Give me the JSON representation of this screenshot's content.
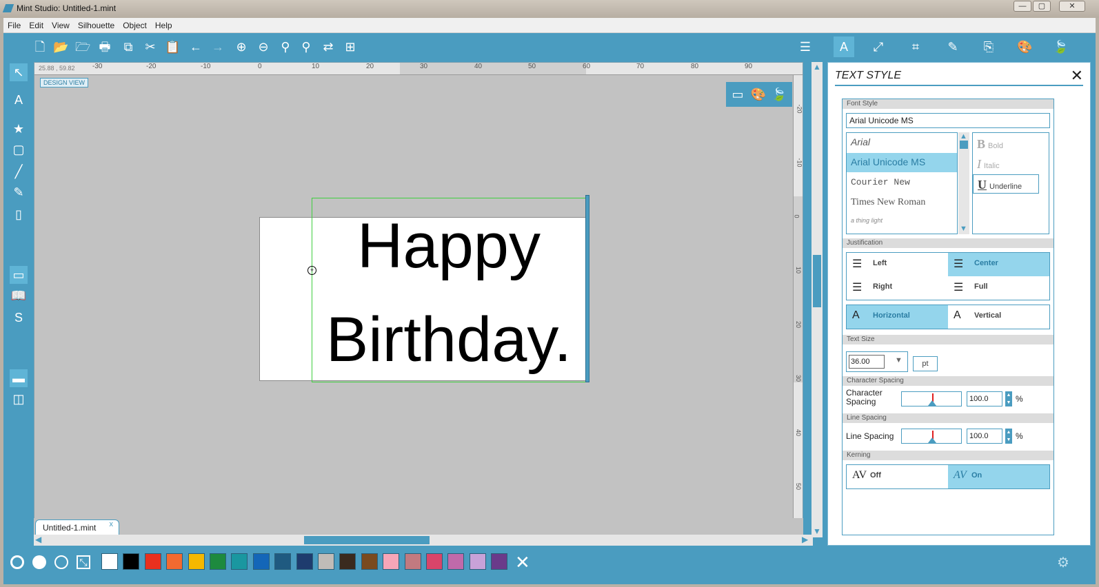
{
  "window": {
    "title": "Mint Studio: Untitled-1.mint",
    "min": "—",
    "max": "▢",
    "close": "✕"
  },
  "menu": [
    "File",
    "Edit",
    "View",
    "Silhouette",
    "Object",
    "Help"
  ],
  "toolbar": {
    "left": [
      {
        "name": "new-document-icon",
        "glyph": "🗋"
      },
      {
        "name": "open-folder-icon",
        "glyph": "📂"
      },
      {
        "name": "recent-folder-icon",
        "glyph": "🗁"
      },
      {
        "name": "print-icon",
        "glyph": "🖶"
      },
      {
        "name": "copy-icon",
        "glyph": "⧉"
      },
      {
        "name": "cut-icon",
        "glyph": "✂"
      },
      {
        "name": "paste-icon",
        "glyph": "📋"
      },
      {
        "name": "undo-icon",
        "glyph": "←"
      },
      {
        "name": "redo-icon",
        "glyph": "→"
      },
      {
        "name": "zoom-in-icon",
        "glyph": "⊕"
      },
      {
        "name": "zoom-out-icon",
        "glyph": "⊖"
      },
      {
        "name": "zoom-selection-icon",
        "glyph": "⚲"
      },
      {
        "name": "zoom-fit-icon",
        "glyph": "⚲"
      },
      {
        "name": "pan-icon",
        "glyph": "⇄"
      },
      {
        "name": "add-page-icon",
        "glyph": "⊞"
      }
    ],
    "right": [
      {
        "name": "page-setup-icon",
        "glyph": "☰"
      },
      {
        "name": "text-style-icon",
        "glyph": "A"
      },
      {
        "name": "transform-icon",
        "glyph": "⤢"
      },
      {
        "name": "crop-icon",
        "glyph": "⌗"
      },
      {
        "name": "trace-icon",
        "glyph": "✎"
      },
      {
        "name": "send-icon",
        "glyph": "⎘"
      },
      {
        "name": "fill-color-icon",
        "glyph": "🎨"
      },
      {
        "name": "library-icon",
        "glyph": "🍃"
      }
    ]
  },
  "left_tools": [
    {
      "name": "select-tool-icon",
      "glyph": "↖"
    },
    {
      "name": "text-tool-icon",
      "glyph": "A"
    },
    {
      "name": "shape-tool-icon",
      "glyph": "★"
    },
    {
      "name": "rectangle-tool-icon",
      "glyph": "▢"
    },
    {
      "name": "line-tool-icon",
      "glyph": "╱"
    },
    {
      "name": "draw-tool-icon",
      "glyph": "✎"
    },
    {
      "name": "eraser-tool-icon",
      "glyph": "▯"
    },
    {
      "name": "design-page-icon",
      "glyph": "▭"
    },
    {
      "name": "library-book-icon",
      "glyph": "📖"
    },
    {
      "name": "silhouette-store-icon",
      "glyph": "S"
    },
    {
      "name": "single-view-icon",
      "glyph": "▬"
    },
    {
      "name": "split-view-icon",
      "glyph": "◫"
    }
  ],
  "canvas": {
    "design_view_label": "DESIGN VIEW",
    "ruler_coords": "25.88 , 59.82",
    "ruler_h_labels": [
      "-30",
      "-20",
      "-10",
      "0",
      "10",
      "20",
      "30",
      "40",
      "50",
      "60",
      "70",
      "80",
      "90"
    ],
    "ruler_v_labels": [
      "-20",
      "-10",
      "0",
      "10",
      "20",
      "30",
      "40",
      "50"
    ],
    "text_lines": [
      "Happy",
      "Birthday."
    ]
  },
  "document_tab": {
    "label": "Untitled-1.mint",
    "close": "x"
  },
  "bottom": {
    "swatches": [
      "#ffffff",
      "#000000",
      "#e8301e",
      "#f26a30",
      "#f5b800",
      "#1d8a3e",
      "#1a97a0",
      "#1466b8",
      "#1f5a80",
      "#1e3c6e",
      "#c0bcb8",
      "#3a2a1e",
      "#7a4a1e",
      "#f7a6b8",
      "#c27a80",
      "#d8456a",
      "#c06aaa",
      "#c8a2d8",
      "#6a3a8a"
    ],
    "close": "✕"
  },
  "panel": {
    "title": "TEXT STYLE",
    "font_style_header": "Font Style",
    "font_value": "Arial Unicode MS",
    "fonts": [
      "Arial",
      "Arial Unicode MS",
      "Courier New",
      "Times New Roman",
      "a thing light"
    ],
    "selected_font": "Arial Unicode MS",
    "styles": {
      "bold": "Bold",
      "italic": "Italic",
      "underline": "Underline"
    },
    "justification_header": "Justification",
    "justify": {
      "left": "Left",
      "center": "Center",
      "right": "Right",
      "full": "Full"
    },
    "orientation": {
      "horizontal": "Horizontal",
      "vertical": "Vertical"
    },
    "text_size_header": "Text Size",
    "text_size": "36.00",
    "unit": "pt",
    "char_spacing_header": "Character Spacing",
    "char_spacing_label": "Character Spacing",
    "char_spacing_value": "100.0",
    "line_spacing_header": "Line Spacing",
    "line_spacing_label": "Line Spacing",
    "line_spacing_value": "100.0",
    "percent": "%",
    "kerning_header": "Kerning",
    "kerning": {
      "off": "Off",
      "on": "On",
      "icon": "AV"
    }
  }
}
